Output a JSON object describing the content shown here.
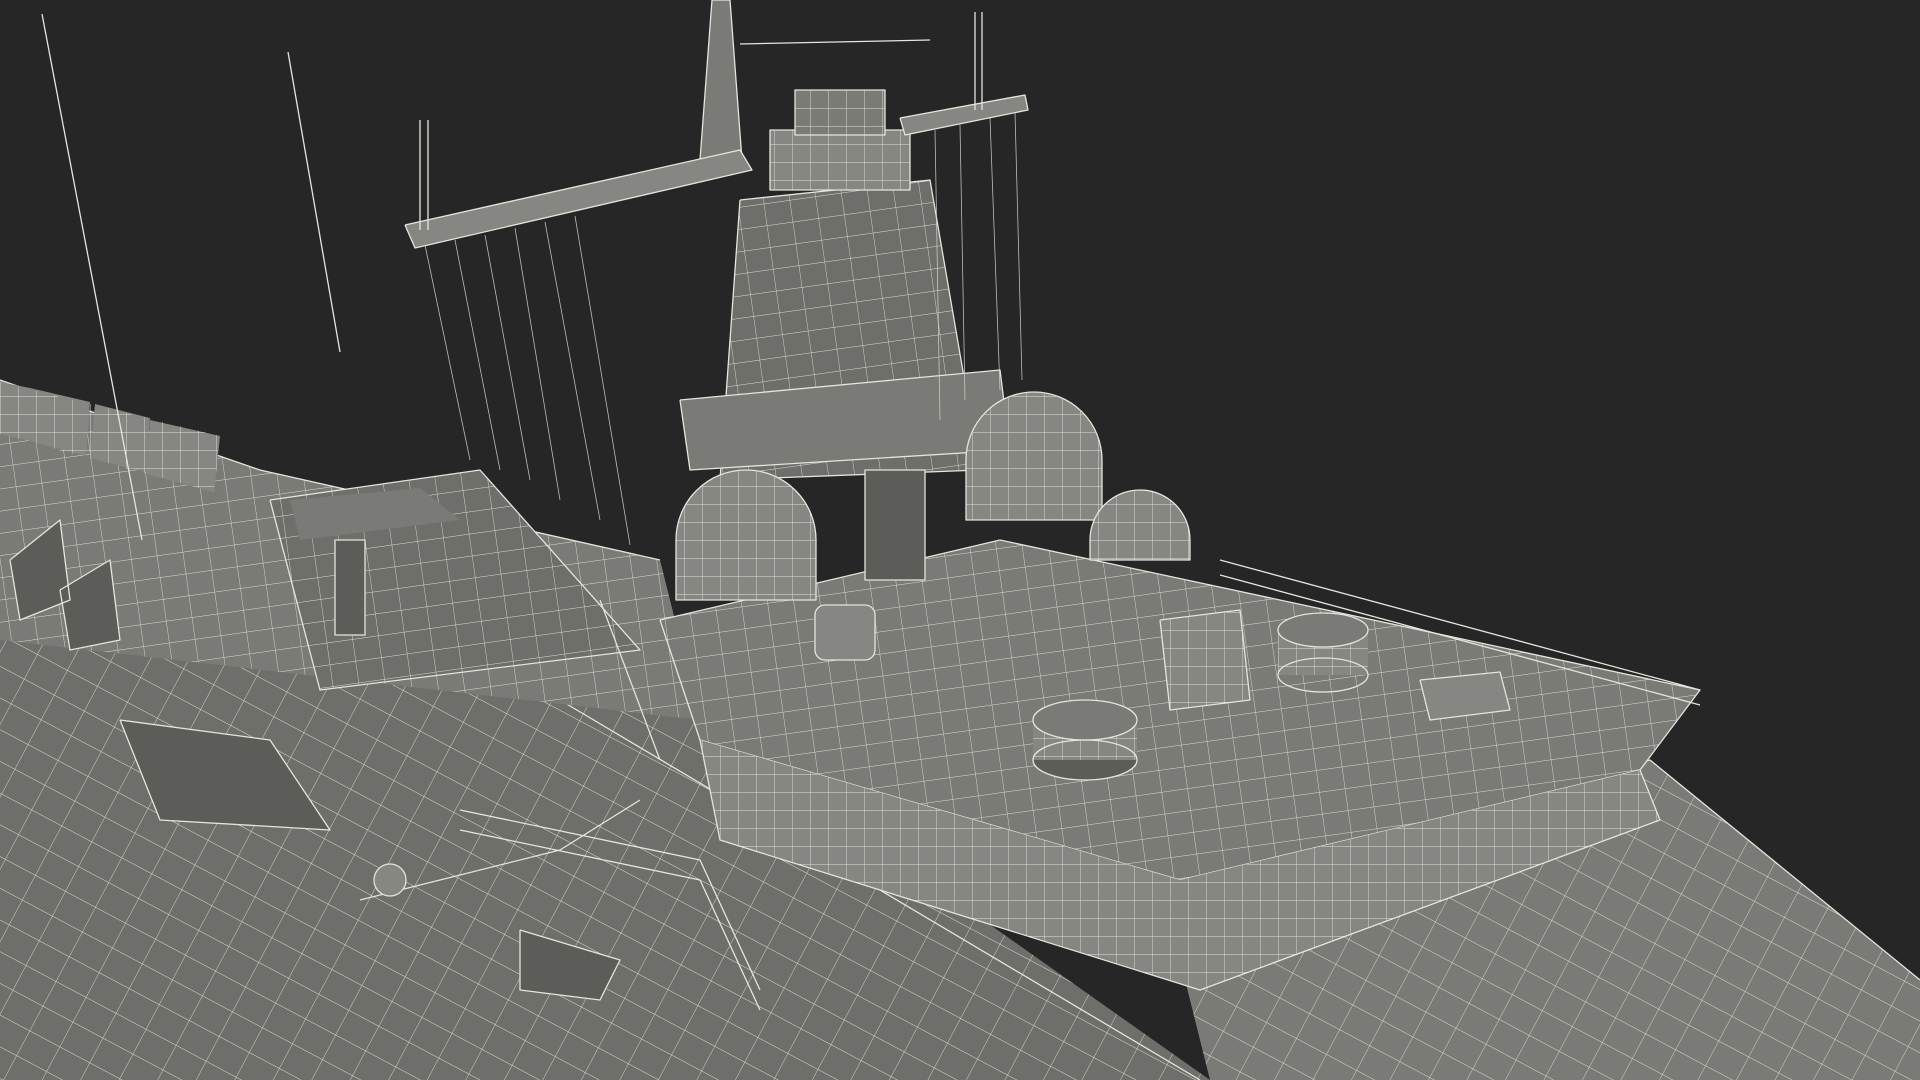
{
  "scene": {
    "background_color": "#262626",
    "surface_color": "#7a7a76",
    "wire_color": "#e6e4dc",
    "subject": "ship-superstructure-wireframe-render"
  }
}
